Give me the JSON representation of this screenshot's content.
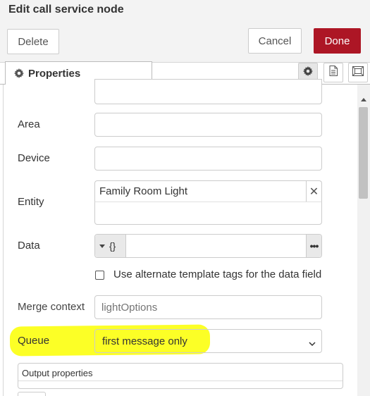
{
  "header": {
    "title": "Edit call service node",
    "delete_label": "Delete",
    "cancel_label": "Cancel",
    "done_label": "Done"
  },
  "tabs": [
    {
      "label": "Properties",
      "icon": "gear-icon"
    }
  ],
  "toolbar_icons": [
    "gear-icon",
    "description-icon",
    "appearance-icon"
  ],
  "form": {
    "area": {
      "label": "Area",
      "value": ""
    },
    "device": {
      "label": "Device",
      "value": ""
    },
    "entity": {
      "label": "Entity",
      "value": "Family Room Light",
      "clear_icon": "close-icon"
    },
    "data": {
      "label": "Data",
      "type_value": "{}",
      "type_icon": "caret-down-icon",
      "more_icon": "ellipsis-icon"
    },
    "alt_template": {
      "label": "Use alternate template tags for the data field",
      "checked": false
    },
    "merge_context": {
      "label": "Merge context",
      "placeholder": "lightOptions"
    },
    "queue": {
      "label": "Queue",
      "value": "first message only"
    },
    "output_properties": {
      "label": "Output properties"
    }
  },
  "colors": {
    "done_button": "#ad1625",
    "highlight": "#fbff00"
  }
}
